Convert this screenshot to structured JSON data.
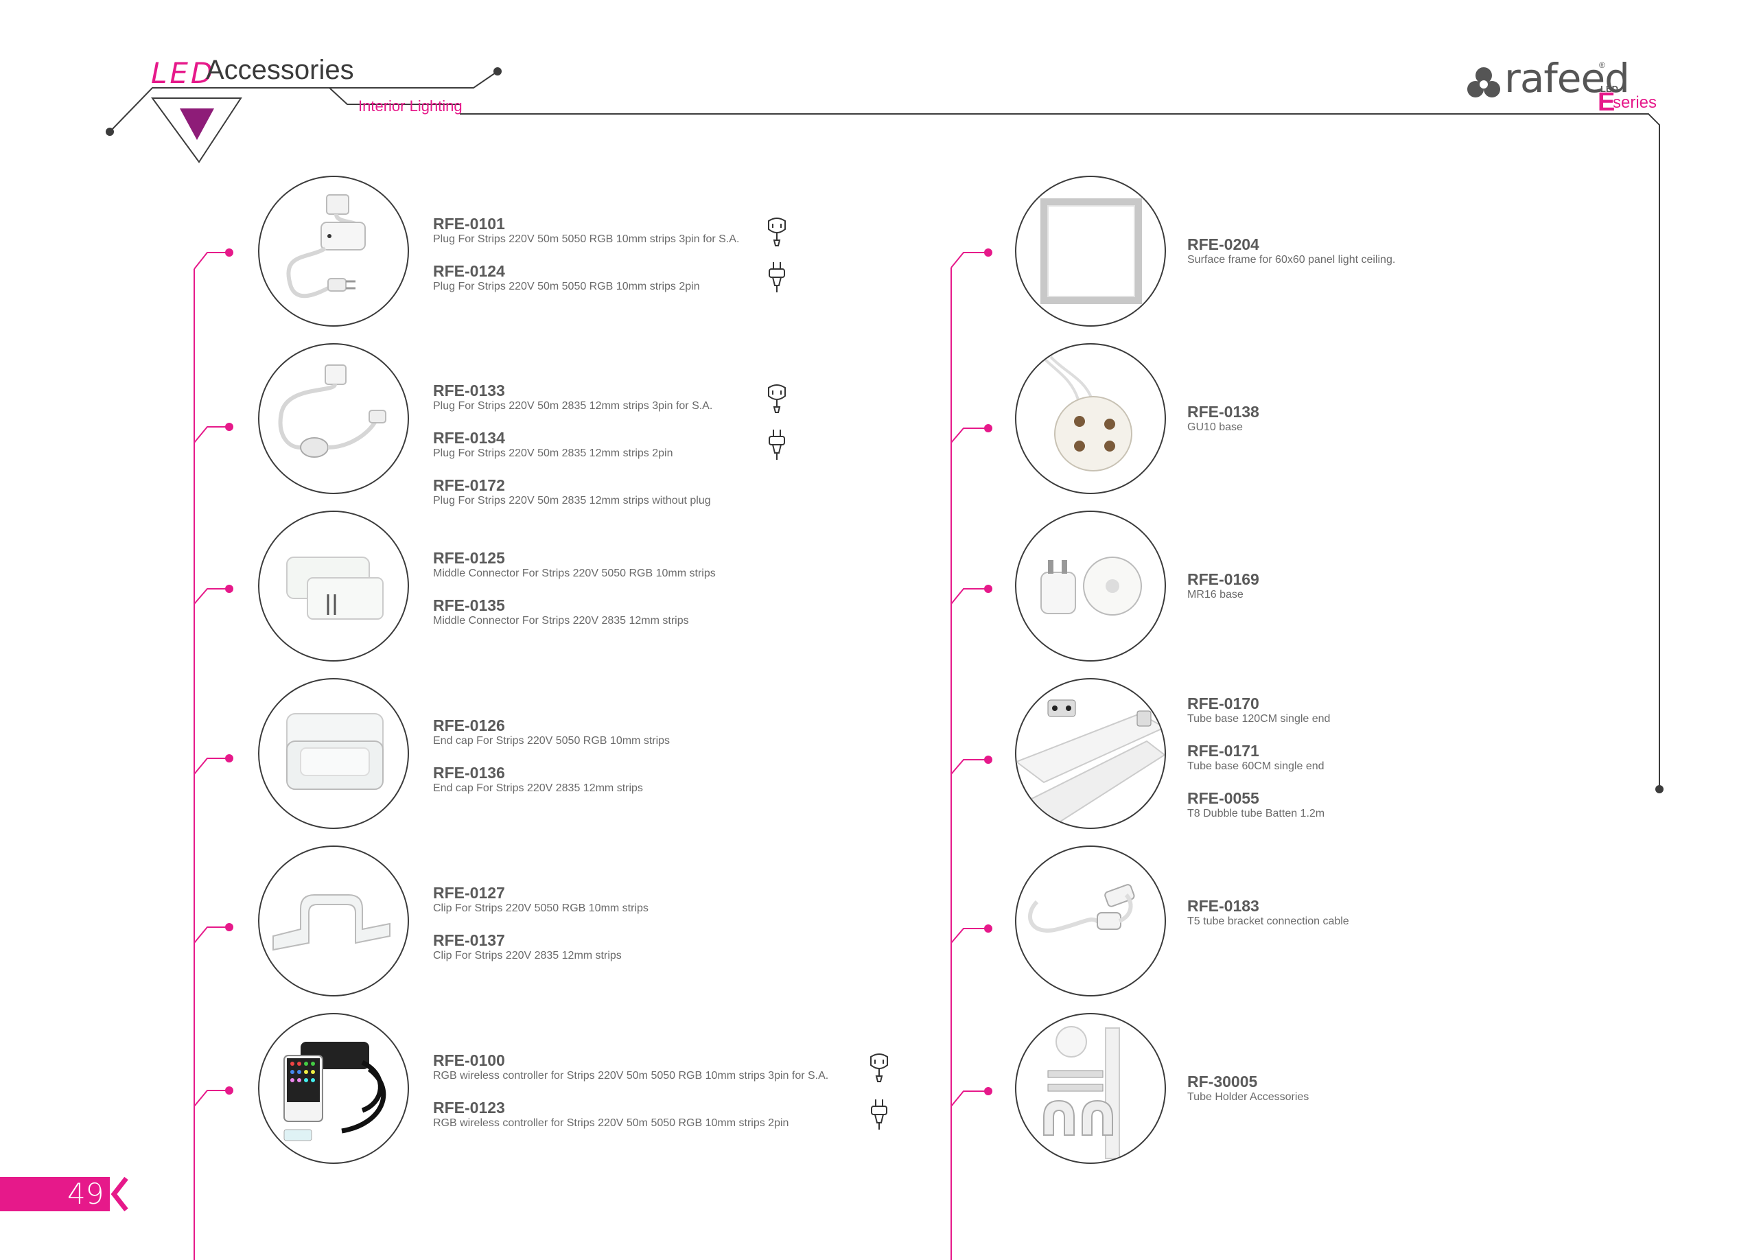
{
  "header": {
    "led_label": "LED",
    "title": "Accessories",
    "subtitle": "Interior Lighting"
  },
  "logo": {
    "brand": "rafeed",
    "led": "LED",
    "e": "E",
    "series": "series",
    "reg": "®"
  },
  "page_number": "49",
  "colors": {
    "accent": "#e6198a",
    "line": "#3c3c3c",
    "text": "#5a5a5a"
  },
  "left_products": [
    {
      "image": "strip-plug-controller",
      "items": [
        {
          "code": "RFE-0101",
          "desc": "Plug For Strips 220V 50m 5050 RGB 10mm strips 3pin  for S.A.",
          "plug": "3pin-plug-icon"
        },
        {
          "code": "RFE-0124",
          "desc": "Plug For Strips 220V 50m 5050 RGB 10mm strips 2pin",
          "plug": "2pin-plug-icon"
        }
      ]
    },
    {
      "image": "strip-plug-cable",
      "items": [
        {
          "code": "RFE-0133",
          "desc": "Plug For Strips 220V 50m 2835 12mm strips 3pin  for S.A.",
          "plug": "3pin-plug-icon"
        },
        {
          "code": "RFE-0134",
          "desc": "Plug For Strips 220V 50m 2835 12mm strips 2pin",
          "plug": "2pin-plug-icon"
        },
        {
          "code": "RFE-0172",
          "desc": "Plug For Strips 220V 50m 2835 12mm strips without plug",
          "plug": ""
        }
      ]
    },
    {
      "image": "middle-connector",
      "items": [
        {
          "code": "RFE-0125",
          "desc": "Middle Connector For Strips 220V 5050 RGB 10mm strips",
          "plug": ""
        },
        {
          "code": "RFE-0135",
          "desc": "Middle Connector For Strips 220V 2835 12mm strips",
          "plug": ""
        }
      ]
    },
    {
      "image": "end-cap",
      "items": [
        {
          "code": "RFE-0126",
          "desc": "End cap For Strips 220V 5050 RGB 10mm strips",
          "plug": ""
        },
        {
          "code": "RFE-0136",
          "desc": "End cap For Strips 220V 2835 12mm strips",
          "plug": ""
        }
      ]
    },
    {
      "image": "strip-clip",
      "items": [
        {
          "code": "RFE-0127",
          "desc": "Clip For Strips 220V 5050 RGB 10mm strips",
          "plug": ""
        },
        {
          "code": "RFE-0137",
          "desc": "Clip For Strips 220V 2835 12mm strips",
          "plug": ""
        }
      ]
    },
    {
      "image": "rgb-remote-controller",
      "items": [
        {
          "code": "RFE-0100",
          "desc": "RGB wireless controller for Strips 220V 50m  5050 RGB 10mm strips 3pin for S.A.",
          "plug": "3pin-plug-icon"
        },
        {
          "code": "RFE-0123",
          "desc": "RGB wireless controller for Strips 220V 50m  5050 RGB 10mm strips 2pin",
          "plug": "2pin-plug-icon"
        }
      ]
    }
  ],
  "right_products": [
    {
      "image": "surface-frame",
      "items": [
        {
          "code": "RFE-0204",
          "desc": "Surface frame for 60x60 panel light ceiling."
        }
      ]
    },
    {
      "image": "gu10-base",
      "items": [
        {
          "code": "RFE-0138",
          "desc": "GU10 base"
        }
      ]
    },
    {
      "image": "mr16-base",
      "items": [
        {
          "code": "RFE-0169",
          "desc": "MR16 base"
        }
      ]
    },
    {
      "image": "tube-base",
      "items": [
        {
          "code": "RFE-0170",
          "desc": "Tube base 120CM single end"
        },
        {
          "code": "RFE-0171",
          "desc": "Tube base 60CM single end"
        },
        {
          "code": "RFE-0055",
          "desc": "T8  Dubble tube Batten 1.2m"
        }
      ]
    },
    {
      "image": "t5-connection-cable",
      "items": [
        {
          "code": "RFE-0183",
          "desc": "T5 tube bracket connection cable"
        }
      ]
    },
    {
      "image": "tube-holder",
      "items": [
        {
          "code": "RF-30005",
          "desc": "Tube Holder Accessories"
        }
      ]
    }
  ]
}
